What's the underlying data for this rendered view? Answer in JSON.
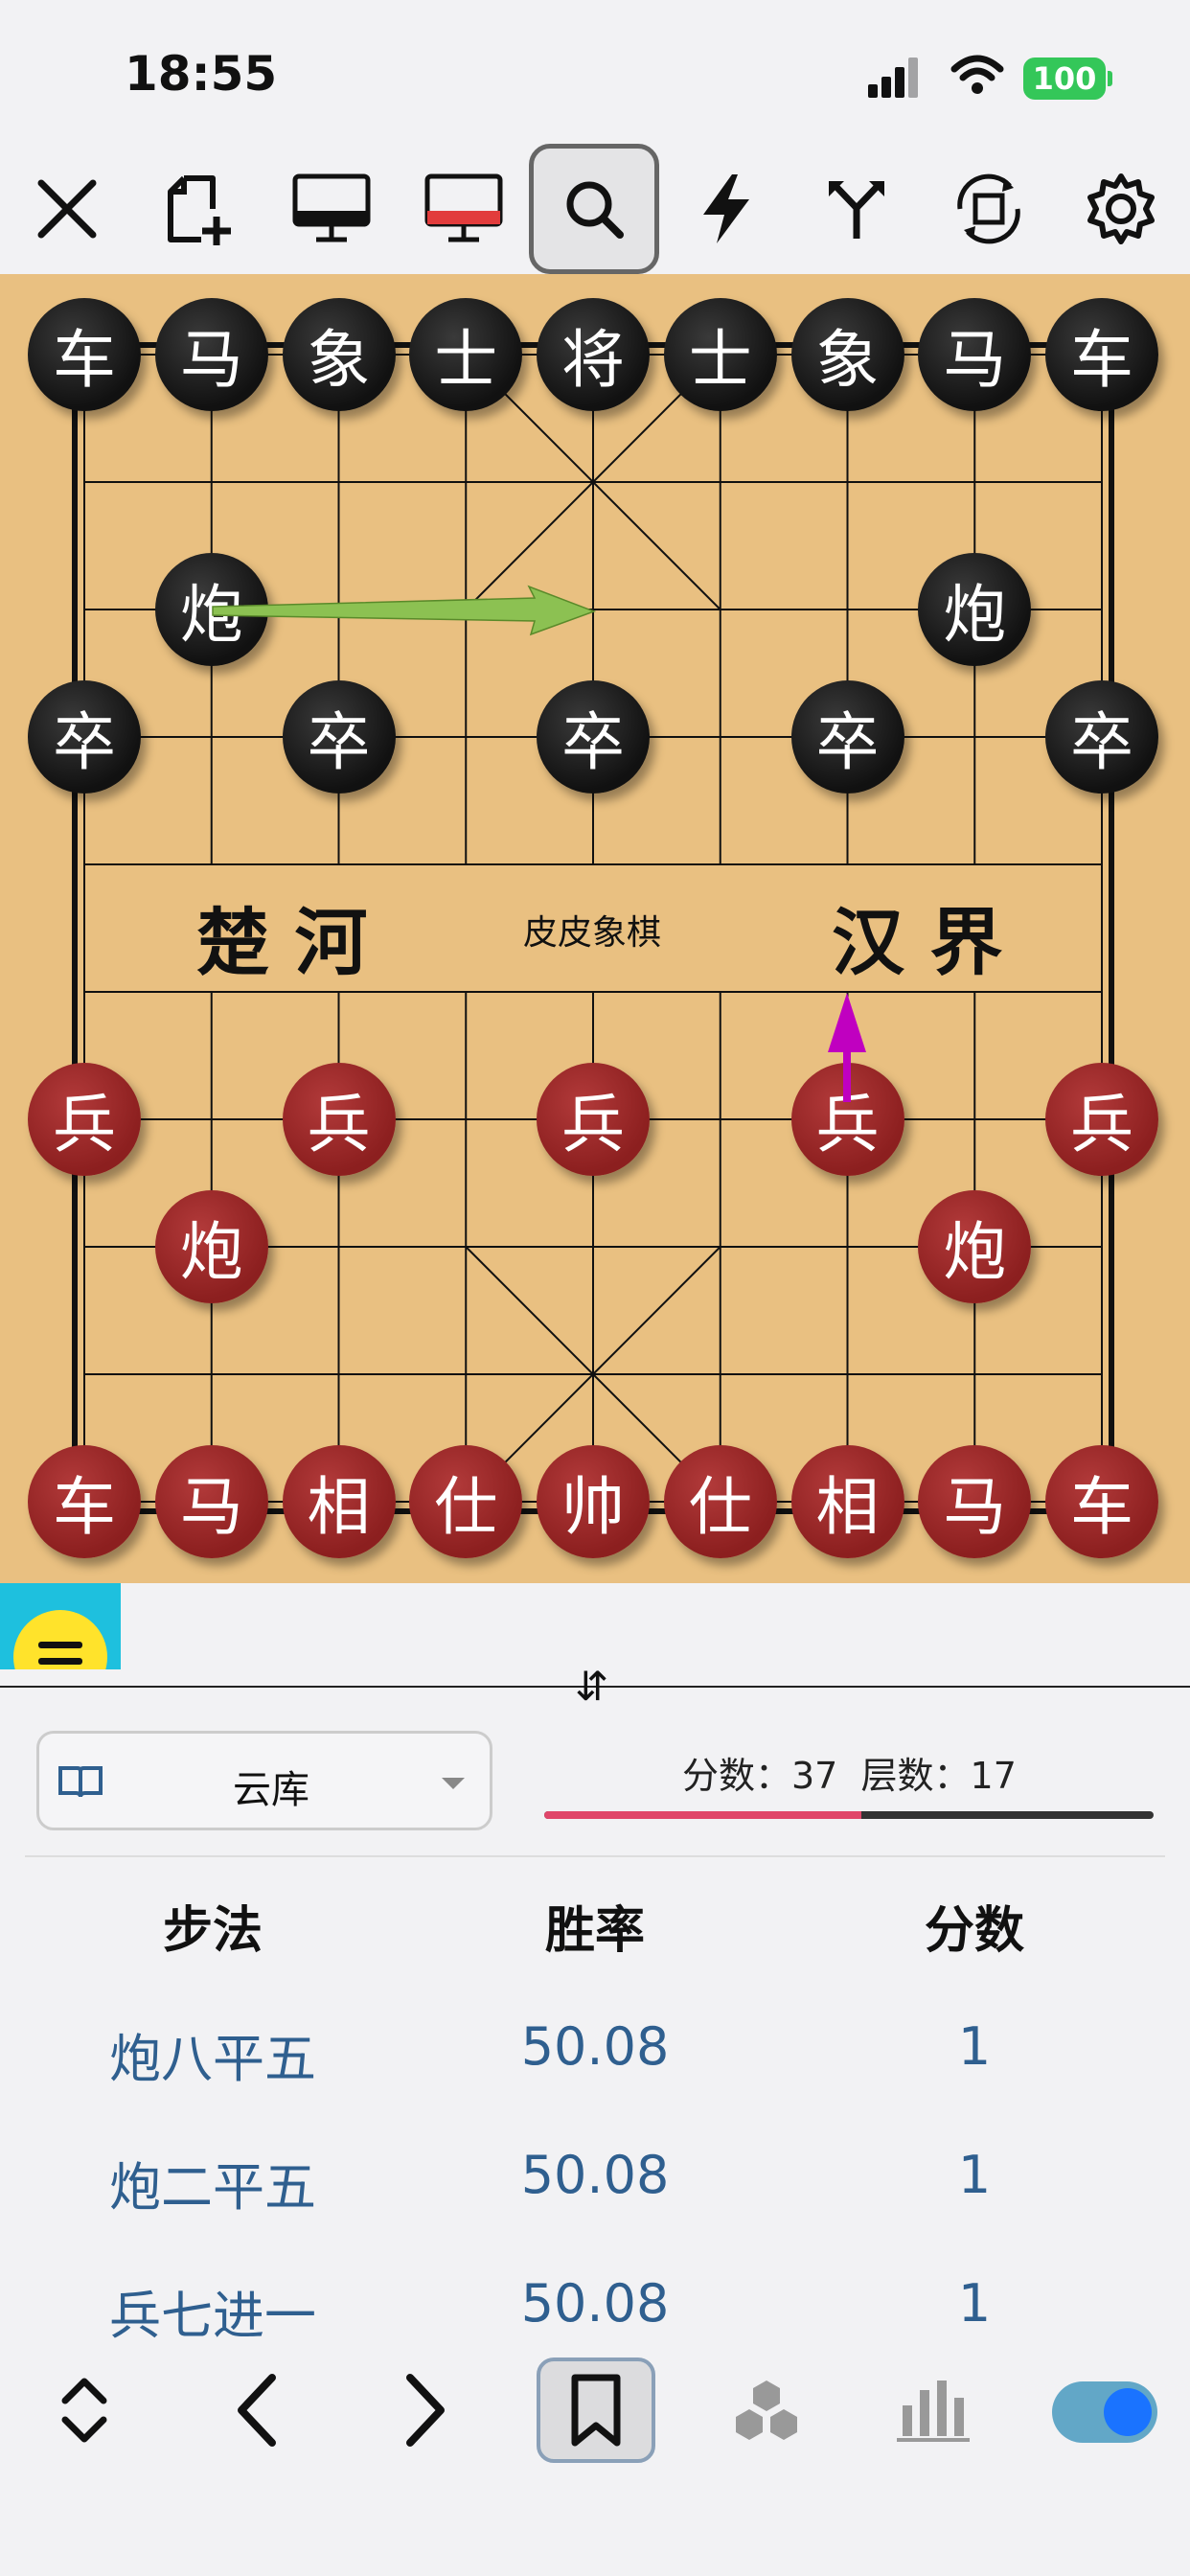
{
  "status_bar": {
    "time": "18:55",
    "battery": "100"
  },
  "toolbar": {
    "items": [
      "close-icon",
      "new-game-icon",
      "black-player-icon",
      "red-player-icon",
      "search-icon",
      "lightning-icon",
      "branch-icon",
      "rotate-board-icon",
      "settings-icon"
    ],
    "active": "search-icon"
  },
  "board": {
    "river_left": "楚 河",
    "river_center": "皮皮象棋",
    "river_right": "汉 界",
    "colors": {
      "board": "#e9c081",
      "black_piece": "#111111",
      "red_piece": "#8c1f1f",
      "arrow_hint": "#8cc152",
      "arrow_last": "#c000c0"
    },
    "pieces": [
      {
        "t": "车",
        "s": "black",
        "c": 0,
        "r": 0
      },
      {
        "t": "马",
        "s": "black",
        "c": 1,
        "r": 0
      },
      {
        "t": "象",
        "s": "black",
        "c": 2,
        "r": 0
      },
      {
        "t": "士",
        "s": "black",
        "c": 3,
        "r": 0
      },
      {
        "t": "将",
        "s": "black",
        "c": 4,
        "r": 0
      },
      {
        "t": "士",
        "s": "black",
        "c": 5,
        "r": 0
      },
      {
        "t": "象",
        "s": "black",
        "c": 6,
        "r": 0
      },
      {
        "t": "马",
        "s": "black",
        "c": 7,
        "r": 0
      },
      {
        "t": "车",
        "s": "black",
        "c": 8,
        "r": 0
      },
      {
        "t": "炮",
        "s": "black",
        "c": 1,
        "r": 2
      },
      {
        "t": "炮",
        "s": "black",
        "c": 7,
        "r": 2
      },
      {
        "t": "卒",
        "s": "black",
        "c": 0,
        "r": 3
      },
      {
        "t": "卒",
        "s": "black",
        "c": 2,
        "r": 3
      },
      {
        "t": "卒",
        "s": "black",
        "c": 4,
        "r": 3
      },
      {
        "t": "卒",
        "s": "black",
        "c": 6,
        "r": 3
      },
      {
        "t": "卒",
        "s": "black",
        "c": 8,
        "r": 3
      },
      {
        "t": "兵",
        "s": "red",
        "c": 0,
        "r": 6
      },
      {
        "t": "兵",
        "s": "red",
        "c": 2,
        "r": 6
      },
      {
        "t": "兵",
        "s": "red",
        "c": 4,
        "r": 6
      },
      {
        "t": "兵",
        "s": "red",
        "c": 6,
        "r": 6
      },
      {
        "t": "兵",
        "s": "red",
        "c": 8,
        "r": 6
      },
      {
        "t": "炮",
        "s": "red",
        "c": 1,
        "r": 7
      },
      {
        "t": "炮",
        "s": "red",
        "c": 7,
        "r": 7
      },
      {
        "t": "车",
        "s": "red",
        "c": 0,
        "r": 9
      },
      {
        "t": "马",
        "s": "red",
        "c": 1,
        "r": 9
      },
      {
        "t": "相",
        "s": "red",
        "c": 2,
        "r": 9
      },
      {
        "t": "仕",
        "s": "red",
        "c": 3,
        "r": 9
      },
      {
        "t": "帅",
        "s": "red",
        "c": 4,
        "r": 9
      },
      {
        "t": "仕",
        "s": "red",
        "c": 5,
        "r": 9
      },
      {
        "t": "相",
        "s": "red",
        "c": 6,
        "r": 9
      },
      {
        "t": "马",
        "s": "red",
        "c": 7,
        "r": 9
      },
      {
        "t": "车",
        "s": "red",
        "c": 8,
        "r": 9
      }
    ]
  },
  "engine_panel": {
    "source_label": "云库",
    "score_text": "分数：37  层数：17",
    "eval_ratio": 0.52,
    "headers": {
      "move": "步法",
      "winrate": "胜率",
      "score": "分数"
    },
    "moves": [
      {
        "move": "炮八平五",
        "winrate": "50.08",
        "score": "1"
      },
      {
        "move": "炮二平五",
        "winrate": "50.08",
        "score": "1"
      },
      {
        "move": "兵七进一",
        "winrate": "50.08",
        "score": "1"
      }
    ]
  },
  "bottom_bar": {
    "items": [
      "expand-icon",
      "back-icon",
      "forward-icon",
      "bookmark-icon",
      "engine-icon",
      "bar-chart-icon",
      "toggle-switch"
    ],
    "active": "bookmark-icon",
    "toggle_on": true
  }
}
